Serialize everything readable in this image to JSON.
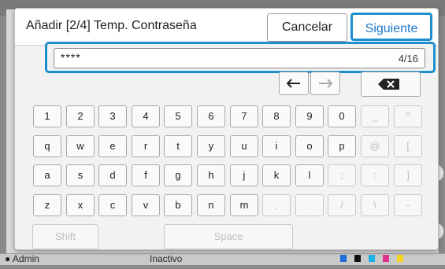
{
  "background": {
    "user_label": "Admin",
    "status_label": "Inactivo",
    "ink_colors": [
      "#1e6fd9",
      "#111111",
      "#19b3e6",
      "#e0308c",
      "#f1d21c"
    ]
  },
  "dialog": {
    "title": "Añadir [2/4] Temp. Contraseña",
    "cancel_label": "Cancelar",
    "next_label": "Siguiente",
    "input_value": "****",
    "input_count": "4/16"
  },
  "keyboard": {
    "nav": {
      "left_arrow": "←",
      "right_arrow": "→",
      "backspace_icon": "backspace-icon"
    },
    "rows": [
      [
        {
          "label": "1",
          "enabled": true
        },
        {
          "label": "2",
          "enabled": true
        },
        {
          "label": "3",
          "enabled": true
        },
        {
          "label": "4",
          "enabled": true
        },
        {
          "label": "5",
          "enabled": true
        },
        {
          "label": "6",
          "enabled": true
        },
        {
          "label": "7",
          "enabled": true
        },
        {
          "label": "8",
          "enabled": true
        },
        {
          "label": "9",
          "enabled": true
        },
        {
          "label": "0",
          "enabled": true
        },
        {
          "label": "_",
          "enabled": false
        },
        {
          "label": "^",
          "enabled": false
        }
      ],
      [
        {
          "label": "q",
          "enabled": true
        },
        {
          "label": "w",
          "enabled": true
        },
        {
          "label": "e",
          "enabled": true
        },
        {
          "label": "r",
          "enabled": true
        },
        {
          "label": "t",
          "enabled": true
        },
        {
          "label": "y",
          "enabled": true
        },
        {
          "label": "u",
          "enabled": true
        },
        {
          "label": "i",
          "enabled": true
        },
        {
          "label": "o",
          "enabled": true
        },
        {
          "label": "p",
          "enabled": true
        },
        {
          "label": "@",
          "enabled": false
        },
        {
          "label": "[",
          "enabled": false
        }
      ],
      [
        {
          "label": "a",
          "enabled": true
        },
        {
          "label": "s",
          "enabled": true
        },
        {
          "label": "d",
          "enabled": true
        },
        {
          "label": "f",
          "enabled": true
        },
        {
          "label": "g",
          "enabled": true
        },
        {
          "label": "h",
          "enabled": true
        },
        {
          "label": "j",
          "enabled": true
        },
        {
          "label": "k",
          "enabled": true
        },
        {
          "label": "l",
          "enabled": true
        },
        {
          "label": ";",
          "enabled": false
        },
        {
          "label": ":",
          "enabled": false
        },
        {
          "label": "]",
          "enabled": false
        }
      ],
      [
        {
          "label": "z",
          "enabled": true
        },
        {
          "label": "x",
          "enabled": true
        },
        {
          "label": "c",
          "enabled": true
        },
        {
          "label": "v",
          "enabled": true
        },
        {
          "label": "b",
          "enabled": true
        },
        {
          "label": "n",
          "enabled": true
        },
        {
          "label": "m",
          "enabled": true
        },
        {
          "label": ",",
          "enabled": false
        },
        {
          "label": ".",
          "enabled": false
        },
        {
          "label": "/",
          "enabled": false
        },
        {
          "label": "\\",
          "enabled": false
        },
        {
          "label": "-",
          "enabled": false
        }
      ]
    ],
    "shift_label": "Shift",
    "space_label": "Space"
  }
}
